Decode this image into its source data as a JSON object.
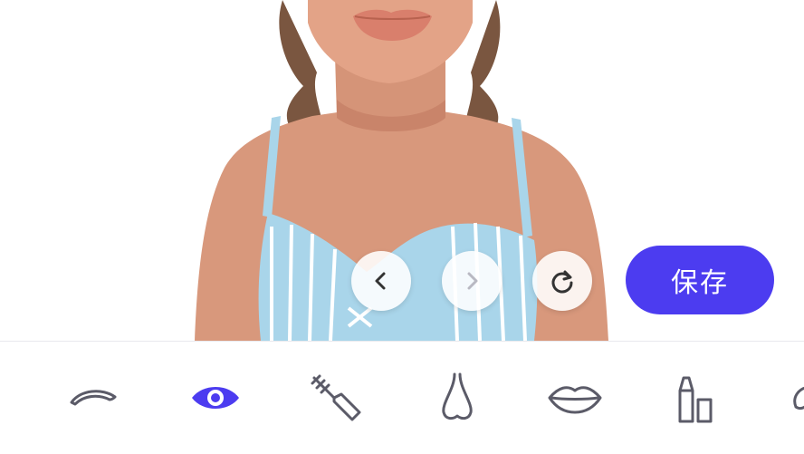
{
  "actions": {
    "save_label": "保存"
  },
  "controls": [
    {
      "name": "undo",
      "icon": "chevron-left-icon",
      "enabled": true
    },
    {
      "name": "redo",
      "icon": "chevron-right-icon",
      "enabled": false
    },
    {
      "name": "reset",
      "icon": "refresh-icon",
      "enabled": true
    }
  ],
  "toolbar": {
    "items": [
      {
        "icon": "eyebrow-icon",
        "selected": false
      },
      {
        "icon": "eye-icon",
        "selected": true
      },
      {
        "icon": "mascara-icon",
        "selected": false
      },
      {
        "icon": "nose-icon",
        "selected": false
      },
      {
        "icon": "lips-icon",
        "selected": false
      },
      {
        "icon": "lipstick-icon",
        "selected": false
      },
      {
        "icon": "face-icon",
        "selected": false
      }
    ]
  },
  "colors": {
    "accent": "#4c3cf0",
    "icon": "#5b5b68",
    "icon_disabled": "#b9b9c2"
  }
}
